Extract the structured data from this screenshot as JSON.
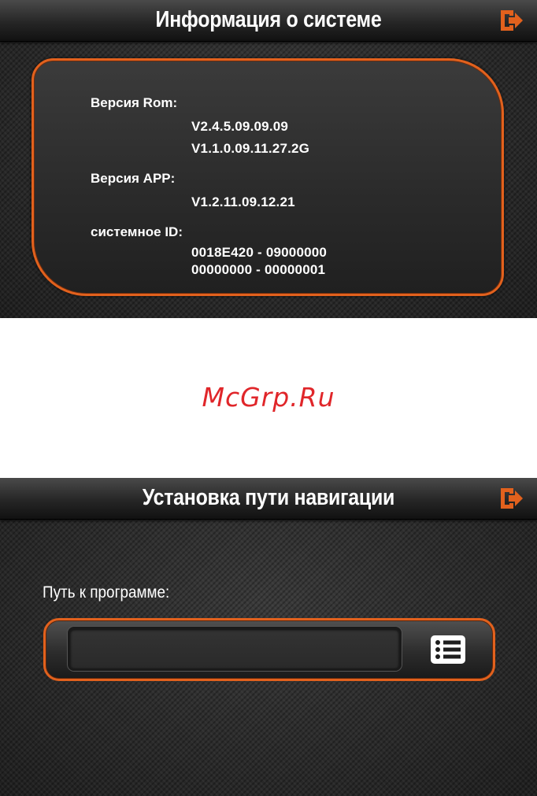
{
  "system_info": {
    "title": "Информация о системе",
    "rom_label": "Версия Rom:",
    "rom_versions": [
      "V2.4.5.09.09.09",
      "V1.1.0.09.11.27.2G"
    ],
    "app_label": "Версия APP:",
    "app_version": "V1.2.11.09.12.21",
    "id_label": "системное ID:",
    "id_lines": [
      "0018E420 - 09000000",
      "00000000 - 00000001"
    ],
    "exit_icon": "exit-icon"
  },
  "watermark": "McGrp.Ru",
  "nav_path": {
    "title": "Установка пути навигации",
    "path_label": "Путь к программе:",
    "path_value": "",
    "browse_icon": "list-icon",
    "exit_icon": "exit-icon"
  },
  "colors": {
    "accent": "#e2611d",
    "watermark": "#e0262a",
    "background": "#2b2b2b"
  }
}
